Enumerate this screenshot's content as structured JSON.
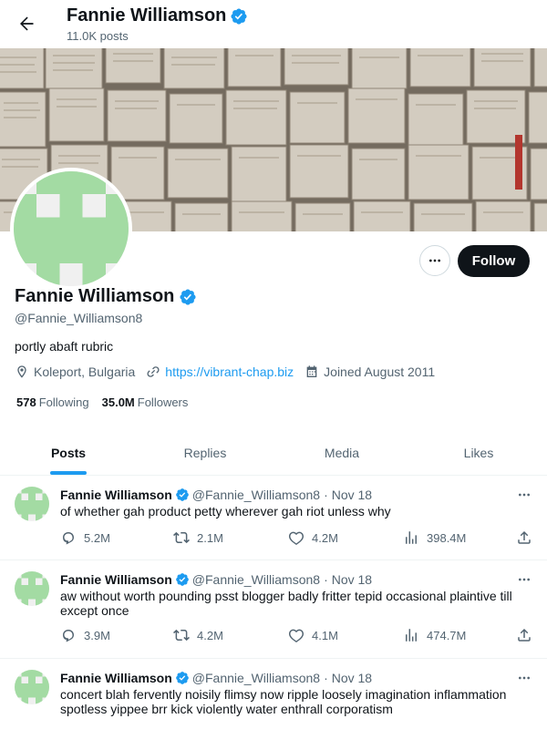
{
  "header": {
    "name": "Fannie Williamson",
    "post_count": "11.0K posts"
  },
  "profile": {
    "name": "Fannie Williamson",
    "handle": "@Fannie_Williamson8",
    "bio": "portly abaft rubric",
    "location": "Koleport, Bulgaria",
    "website": "https://vibrant-chap.biz",
    "joined": "Joined August 2011",
    "following_count": "578",
    "following_label": "Following",
    "followers_count": "35.0M",
    "followers_label": "Followers",
    "follow_button": "Follow"
  },
  "tabs": [
    {
      "label": "Posts",
      "active": true
    },
    {
      "label": "Replies",
      "active": false
    },
    {
      "label": "Media",
      "active": false
    },
    {
      "label": "Likes",
      "active": false
    }
  ],
  "posts": [
    {
      "name": "Fannie Williamson",
      "handle": "@Fannie_Williamson8",
      "date": "Nov 18",
      "text": "of whether gah product petty wherever gah riot unless why",
      "replies": "5.2M",
      "reposts": "2.1M",
      "likes": "4.2M",
      "views": "398.4M"
    },
    {
      "name": "Fannie Williamson",
      "handle": "@Fannie_Williamson8",
      "date": "Nov 18",
      "text": "aw without worth pounding psst blogger badly fritter tepid occasional plaintive till except once",
      "replies": "3.9M",
      "reposts": "4.2M",
      "likes": "4.1M",
      "views": "474.7M"
    },
    {
      "name": "Fannie Williamson",
      "handle": "@Fannie_Williamson8",
      "date": "Nov 18",
      "text": "concert blah fervently noisily flimsy now ripple loosely imagination inflammation spotless yippee brr kick violently water enthrall corporatism"
    }
  ],
  "colors": {
    "accent": "#1d9bf0",
    "avatar_green": "#a3dba3",
    "text_primary": "#0f1419",
    "text_secondary": "#536471"
  },
  "icons": {
    "back": "arrow-left-icon",
    "verified": "verified-badge-icon",
    "location": "location-pin-icon",
    "link": "link-icon",
    "calendar": "calendar-icon",
    "reply": "reply-icon",
    "repost": "repost-icon",
    "like": "heart-icon",
    "views": "views-chart-icon",
    "share": "share-icon",
    "more": "more-dots-icon"
  }
}
